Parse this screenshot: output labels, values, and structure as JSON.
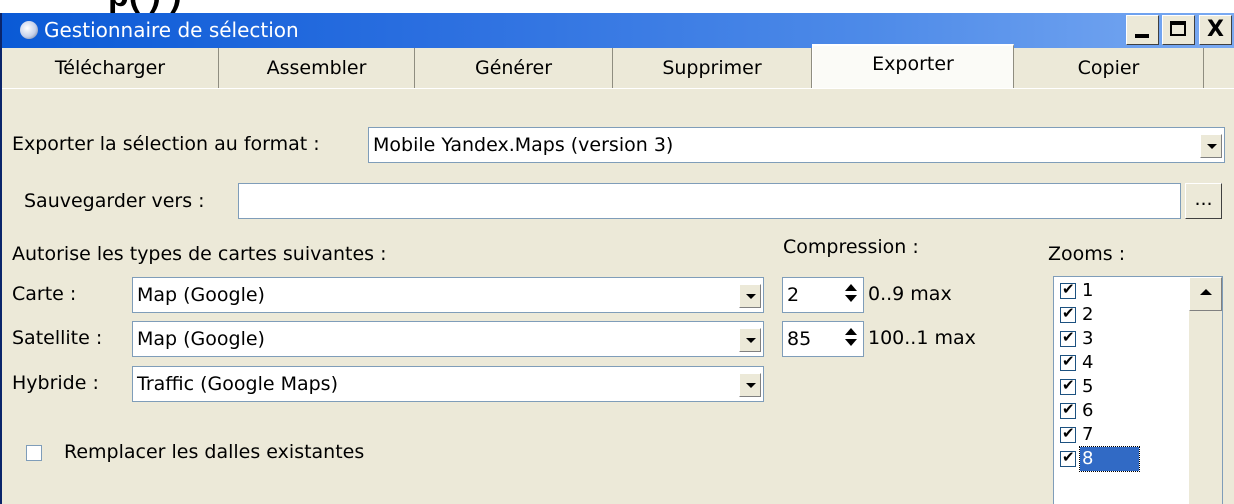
{
  "top_text": "p( ) )",
  "window": {
    "title": "Gestionnaire de sélection",
    "buttons": {
      "minimize": "_",
      "maximize": "□",
      "close": "X"
    }
  },
  "tabs": [
    {
      "label": "Télécharger",
      "active": false
    },
    {
      "label": "Assembler",
      "active": false
    },
    {
      "label": "Générer",
      "active": false
    },
    {
      "label": "Supprimer",
      "active": false
    },
    {
      "label": "Exporter",
      "active": true
    },
    {
      "label": "Copier",
      "active": false
    }
  ],
  "export": {
    "format_label": "Exporter la sélection au format :",
    "format_value": "Mobile Yandex.Maps (version 3)",
    "save_label": "Sauvegarder vers :",
    "save_value": "",
    "browse_label": "...",
    "map_types_label": "Autorise les types de cartes suivantes :",
    "compression_label": "Compression :",
    "zooms_label": "Zooms :"
  },
  "map_types": [
    {
      "label": "Carte :",
      "value": "Map (Google)"
    },
    {
      "label": "Satellite :",
      "value": "Map (Google)"
    },
    {
      "label": "Hybride :",
      "value": "Traffic (Google Maps)"
    }
  ],
  "compression": [
    {
      "value": "2",
      "range": "0..9 max"
    },
    {
      "value": "85",
      "range": "100..1 max"
    }
  ],
  "replace_tiles": {
    "label": "Remplacer les dalles existantes",
    "checked": false
  },
  "zooms": [
    {
      "label": "1",
      "checked": true,
      "selected": false
    },
    {
      "label": "2",
      "checked": true,
      "selected": false
    },
    {
      "label": "3",
      "checked": true,
      "selected": false
    },
    {
      "label": "4",
      "checked": true,
      "selected": false
    },
    {
      "label": "5",
      "checked": true,
      "selected": false
    },
    {
      "label": "6",
      "checked": true,
      "selected": false
    },
    {
      "label": "7",
      "checked": true,
      "selected": false
    },
    {
      "label": "8",
      "checked": true,
      "selected": true
    }
  ],
  "colors": {
    "titlebar_start": "#0a5ad6",
    "titlebar_end": "#7aaaf2",
    "dialog_bg": "#ece9d8",
    "selection": "#316ac5"
  }
}
